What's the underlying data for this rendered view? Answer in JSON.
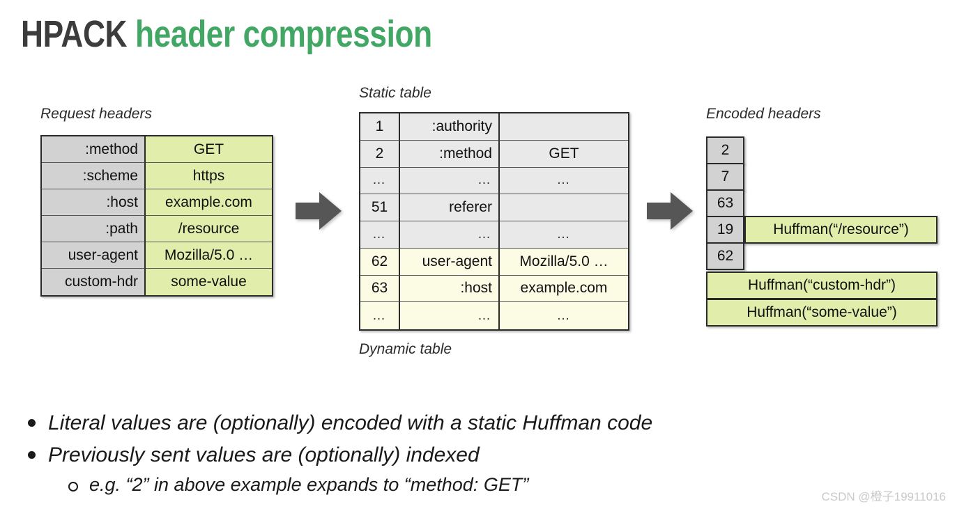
{
  "title": {
    "part1": "HPACK",
    "part2": "header compression",
    "color_dark": "#3c3c3c",
    "color_green": "#42a765"
  },
  "colors": {
    "green_fill": "#e1eeab",
    "gray_fill": "#d2d2d2",
    "light_gray_fill": "#e9e9e9",
    "cream_fill": "#fcfbe4",
    "border": "#2b2b2b",
    "arrow": "#565656"
  },
  "request_headers": {
    "caption": "Request headers",
    "rows": [
      {
        "name": ":method",
        "value": "GET"
      },
      {
        "name": ":scheme",
        "value": "https"
      },
      {
        "name": ":host",
        "value": "example.com"
      },
      {
        "name": ":path",
        "value": "/resource"
      },
      {
        "name": "user-agent",
        "value": "Mozilla/5.0 …"
      },
      {
        "name": "custom-hdr",
        "value": "some-value"
      }
    ]
  },
  "index_table": {
    "caption_top": "Static table",
    "caption_bottom": "Dynamic table",
    "rows": [
      {
        "index": "1",
        "name": ":authority",
        "value": "",
        "section": "static"
      },
      {
        "index": "2",
        "name": ":method",
        "value": "GET",
        "section": "static"
      },
      {
        "index": "…",
        "name": "…",
        "value": "…",
        "section": "static"
      },
      {
        "index": "51",
        "name": "referer",
        "value": "",
        "section": "static"
      },
      {
        "index": "…",
        "name": "…",
        "value": "…",
        "section": "static"
      },
      {
        "index": "62",
        "name": "user-agent",
        "value": "Mozilla/5.0 …",
        "section": "dynamic"
      },
      {
        "index": "63",
        "name": ":host",
        "value": "example.com",
        "section": "dynamic"
      },
      {
        "index": "…",
        "name": "…",
        "value": "…",
        "section": "dynamic"
      }
    ]
  },
  "encoded_headers": {
    "caption": "Encoded headers",
    "indices": [
      "2",
      "7",
      "63",
      "19",
      "62"
    ],
    "literals": [
      "Huffman(“/resource”)",
      "Huffman(“custom-hdr”)",
      "Huffman(“some-value”)"
    ]
  },
  "arrows": {
    "arrow1_label": "right-arrow",
    "arrow2_label": "right-arrow"
  },
  "bullets": [
    {
      "level": 1,
      "text": "Literal values are (optionally) encoded with a static Huffman code"
    },
    {
      "level": 1,
      "text": "Previously sent values are (optionally) indexed"
    },
    {
      "level": 2,
      "text": "e.g. “2” in above example expands to “method: GET”"
    }
  ],
  "watermark": "CSDN @橙子19911016"
}
